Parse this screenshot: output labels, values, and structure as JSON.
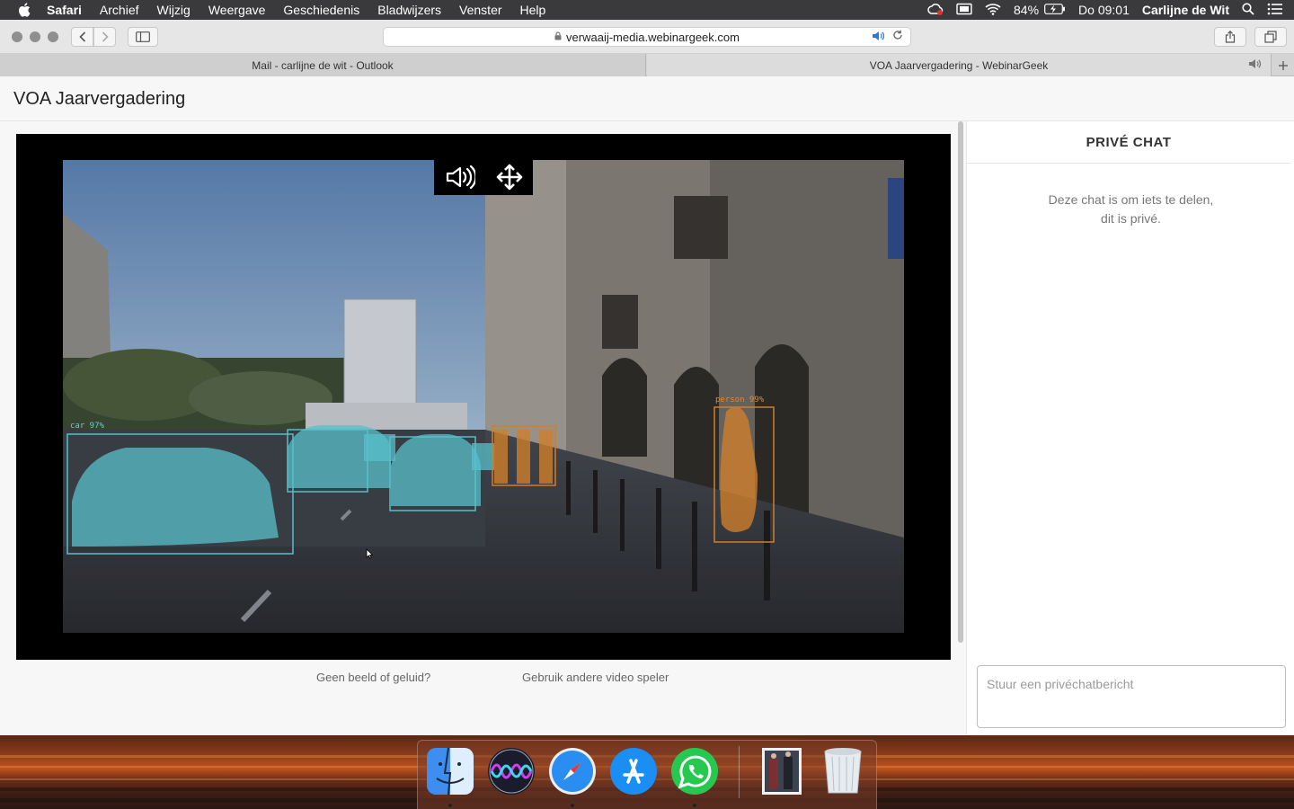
{
  "menubar": {
    "app_name": "Safari",
    "items": [
      "Archief",
      "Wijzig",
      "Weergave",
      "Geschiedenis",
      "Bladwijzers",
      "Venster",
      "Help"
    ],
    "battery": "84%",
    "clock": "Do 09:01",
    "user": "Carlijne de Wit"
  },
  "browser": {
    "url": "verwaaij-media.webinargeek.com",
    "tabs": [
      {
        "title": "Mail - carlijne de wit - Outlook"
      },
      {
        "title": "VOA Jaarvergadering - WebinarGeek"
      }
    ]
  },
  "page": {
    "title": "VOA Jaarvergadering",
    "video": {
      "detections": [
        {
          "label": "car 97%",
          "color": "#5fd0dc"
        },
        {
          "label": "person 99%",
          "color": "#e08a30"
        }
      ]
    },
    "links": {
      "no_media": "Geen beeld of geluid?",
      "alt_player": "Gebruik andere video speler"
    }
  },
  "chat": {
    "header": "PRIVÉ CHAT",
    "info_line1": "Deze chat is om iets te delen,",
    "info_line2": "dit is privé.",
    "input_placeholder": "Stuur een privéchatbericht"
  },
  "dock": {
    "apps": [
      "Finder",
      "Siri",
      "Safari",
      "App Store",
      "WhatsApp",
      "Photos stack",
      "Trash"
    ]
  },
  "colors": {
    "accent": "#2a7bd6",
    "detection_car": "#5fd0dc",
    "detection_person": "#e08a30"
  }
}
